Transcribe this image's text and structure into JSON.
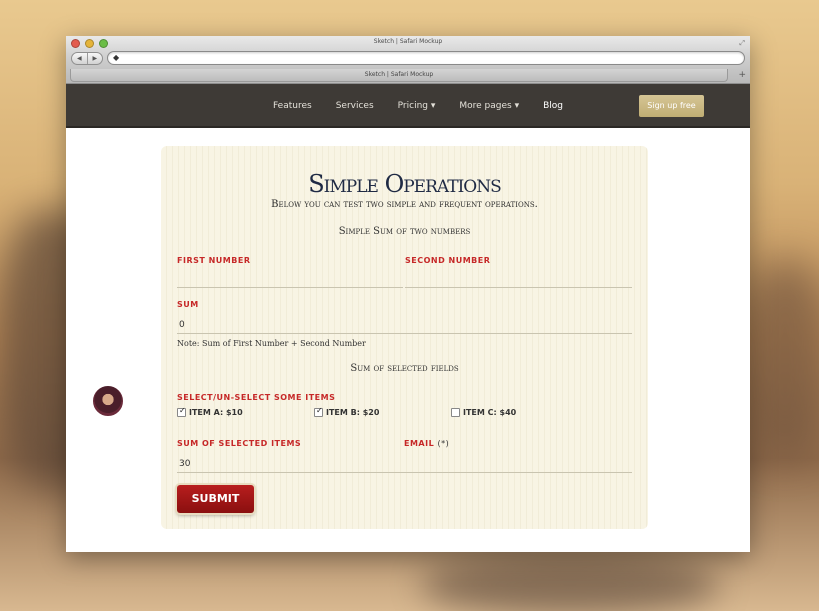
{
  "browser": {
    "window_title": "Sketch | Safari Mockup",
    "tab_title": "Sketch | Safari Mockup",
    "url": "",
    "back_icon": "◀",
    "forward_icon": "▶",
    "new_tab_icon": "+"
  },
  "nav": {
    "items": [
      "Features",
      "Services",
      "Pricing ▾",
      "More pages ▾",
      "Blog"
    ],
    "signup_label": "Sign up free"
  },
  "form": {
    "title": "Simple Operations",
    "subtitle": "Below you can test two simple and frequent operations.",
    "section1_title": "Simple Sum of two numbers",
    "first_number_label": "FIRST NUMBER",
    "first_number_value": "",
    "second_number_label": "SECOND NUMBER",
    "second_number_value": "",
    "sum_label": "SUM",
    "sum_value": "0",
    "note": "Note: Sum of First Number + Second Number",
    "section2_title": "Sum of selected fields",
    "select_label": "SELECT/UN-SELECT SOME ITEMS",
    "items": [
      {
        "label": "ITEM A: $10",
        "checked": true
      },
      {
        "label": "ITEM B: $20",
        "checked": true
      },
      {
        "label": "ITEM C: $40",
        "checked": false
      }
    ],
    "sum_selected_label": "SUM OF SELECTED ITEMS",
    "sum_selected_value": "30",
    "email_label": "EMAIL",
    "email_required": "(*)",
    "email_value": "",
    "submit_label": "SUBMIT"
  },
  "colors": {
    "navbar": "#3e3a36",
    "label_red": "#c62828",
    "submit_red": "#a01515",
    "signup_gold": "#c9b783"
  }
}
